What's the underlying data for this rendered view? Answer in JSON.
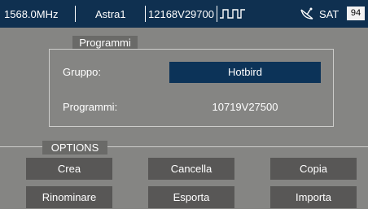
{
  "status_bar": {
    "frequency": "1568.0MHz",
    "satellite": "Astra1",
    "transponder": "12168V29700",
    "wave_icon": "square-wave-icon",
    "dish_icon": "satellite-dish-icon",
    "mode": "SAT",
    "signal_level": "94"
  },
  "programmi_section": {
    "title": "Programmi",
    "gruppo_label": "Gruppo:",
    "gruppo_value": "Hotbird",
    "programmi_label": "Programmi:",
    "programmi_value": "10719V27500"
  },
  "options_section": {
    "title": "OPTIONS",
    "buttons": {
      "crea": "Crea",
      "cancella": "Cancella",
      "copia": "Copia",
      "rinominare": "Rinominare",
      "esporta": "Esporta",
      "importa": "Importa"
    }
  },
  "colors": {
    "status_bar_bg": "#0f3050",
    "screen_bg": "#858583",
    "selected_field_bg": "#0c3358",
    "button_bg": "#585756"
  }
}
